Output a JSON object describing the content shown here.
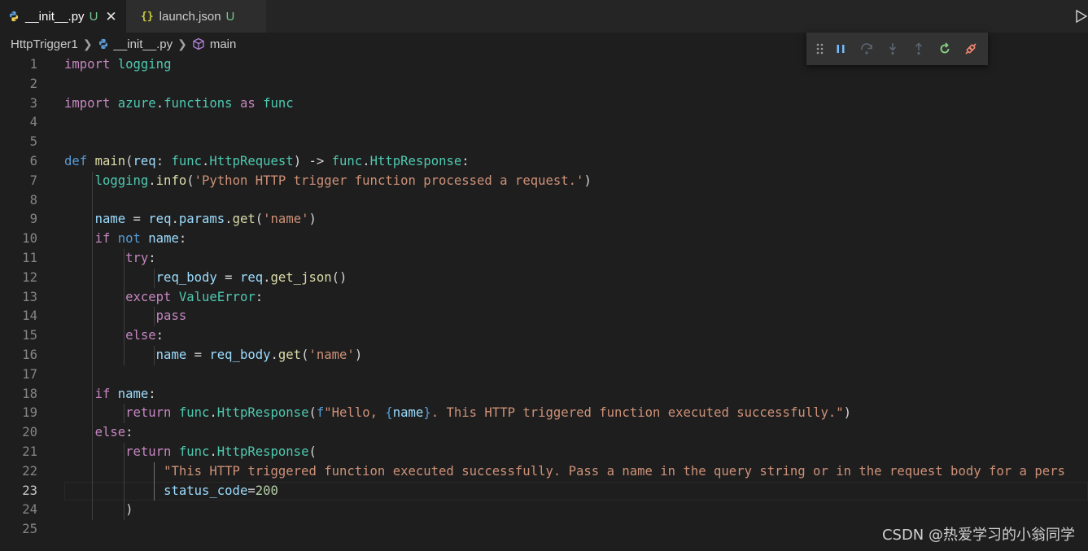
{
  "tabs": [
    {
      "label": "__init__.py",
      "status": "U"
    },
    {
      "label": "launch.json",
      "status": "U",
      "icon_text": "{}"
    }
  ],
  "breadcrumb": {
    "items": [
      "HttpTrigger1",
      "__init__.py",
      "main"
    ]
  },
  "debug_toolbar": {
    "buttons": [
      "drag-grip",
      "pause",
      "step-over",
      "step-into",
      "step-out",
      "restart",
      "disconnect"
    ]
  },
  "editor": {
    "language": "python",
    "current_line": 23,
    "lines": [
      {
        "n": "1",
        "tokens": [
          [
            "import",
            "kw"
          ],
          [
            " ",
            "p"
          ],
          [
            "logging",
            "cls"
          ]
        ]
      },
      {
        "n": "2",
        "tokens": []
      },
      {
        "n": "3",
        "tokens": [
          [
            "import",
            "kw"
          ],
          [
            " ",
            "p"
          ],
          [
            "azure",
            "cls"
          ],
          [
            ".",
            "p"
          ],
          [
            "functions",
            "cls"
          ],
          [
            " ",
            "p"
          ],
          [
            "as",
            "kw"
          ],
          [
            " ",
            "p"
          ],
          [
            "func",
            "cls"
          ]
        ]
      },
      {
        "n": "4",
        "tokens": []
      },
      {
        "n": "5",
        "tokens": []
      },
      {
        "n": "6",
        "tokens": [
          [
            "def",
            "def"
          ],
          [
            " ",
            "p"
          ],
          [
            "main",
            "fn"
          ],
          [
            "(",
            "p"
          ],
          [
            "req",
            "var"
          ],
          [
            ": ",
            "p"
          ],
          [
            "func",
            "cls"
          ],
          [
            ".",
            "p"
          ],
          [
            "HttpRequest",
            "cls"
          ],
          [
            ") -> ",
            "p"
          ],
          [
            "func",
            "cls"
          ],
          [
            ".",
            "p"
          ],
          [
            "HttpResponse",
            "cls"
          ],
          [
            ":",
            "p"
          ]
        ]
      },
      {
        "n": "7",
        "tokens": [
          [
            "    ",
            "p"
          ],
          [
            "logging",
            "cls"
          ],
          [
            ".",
            "p"
          ],
          [
            "info",
            "fn"
          ],
          [
            "(",
            "p"
          ],
          [
            "'Python HTTP trigger function processed a request.'",
            "str"
          ],
          [
            ")",
            "p"
          ]
        ]
      },
      {
        "n": "8",
        "tokens": []
      },
      {
        "n": "9",
        "tokens": [
          [
            "    ",
            "p"
          ],
          [
            "name",
            "var"
          ],
          [
            " = ",
            "p"
          ],
          [
            "req",
            "var"
          ],
          [
            ".",
            "p"
          ],
          [
            "params",
            "var"
          ],
          [
            ".",
            "p"
          ],
          [
            "get",
            "fn"
          ],
          [
            "(",
            "p"
          ],
          [
            "'name'",
            "str"
          ],
          [
            ")",
            "p"
          ]
        ]
      },
      {
        "n": "10",
        "tokens": [
          [
            "    ",
            "p"
          ],
          [
            "if",
            "kw"
          ],
          [
            " ",
            "p"
          ],
          [
            "not",
            "def"
          ],
          [
            " ",
            "p"
          ],
          [
            "name",
            "var"
          ],
          [
            ":",
            "p"
          ]
        ]
      },
      {
        "n": "11",
        "tokens": [
          [
            "        ",
            "p"
          ],
          [
            "try",
            "kw"
          ],
          [
            ":",
            "p"
          ]
        ]
      },
      {
        "n": "12",
        "tokens": [
          [
            "            ",
            "p"
          ],
          [
            "req_body",
            "var"
          ],
          [
            " = ",
            "p"
          ],
          [
            "req",
            "var"
          ],
          [
            ".",
            "p"
          ],
          [
            "get_json",
            "fn"
          ],
          [
            "()",
            "p"
          ]
        ]
      },
      {
        "n": "13",
        "tokens": [
          [
            "        ",
            "p"
          ],
          [
            "except",
            "kw"
          ],
          [
            " ",
            "p"
          ],
          [
            "ValueError",
            "cls"
          ],
          [
            ":",
            "p"
          ]
        ]
      },
      {
        "n": "14",
        "tokens": [
          [
            "            ",
            "p"
          ],
          [
            "pass",
            "kw"
          ]
        ]
      },
      {
        "n": "15",
        "tokens": [
          [
            "        ",
            "p"
          ],
          [
            "else",
            "kw"
          ],
          [
            ":",
            "p"
          ]
        ]
      },
      {
        "n": "16",
        "tokens": [
          [
            "            ",
            "p"
          ],
          [
            "name",
            "var"
          ],
          [
            " = ",
            "p"
          ],
          [
            "req_body",
            "var"
          ],
          [
            ".",
            "p"
          ],
          [
            "get",
            "fn"
          ],
          [
            "(",
            "p"
          ],
          [
            "'name'",
            "str"
          ],
          [
            ")",
            "p"
          ]
        ]
      },
      {
        "n": "17",
        "tokens": []
      },
      {
        "n": "18",
        "tokens": [
          [
            "    ",
            "p"
          ],
          [
            "if",
            "kw"
          ],
          [
            " ",
            "p"
          ],
          [
            "name",
            "var"
          ],
          [
            ":",
            "p"
          ]
        ]
      },
      {
        "n": "19",
        "tokens": [
          [
            "        ",
            "p"
          ],
          [
            "return",
            "kw"
          ],
          [
            " ",
            "p"
          ],
          [
            "func",
            "cls"
          ],
          [
            ".",
            "p"
          ],
          [
            "HttpResponse",
            "cls"
          ],
          [
            "(",
            "p"
          ],
          [
            "f",
            "def"
          ],
          [
            "\"Hello, ",
            "str"
          ],
          [
            "{",
            "brace"
          ],
          [
            "name",
            "var"
          ],
          [
            "}",
            "brace"
          ],
          [
            ". This HTTP triggered function executed successfully.\"",
            "str"
          ],
          [
            ")",
            "p"
          ]
        ]
      },
      {
        "n": "20",
        "tokens": [
          [
            "    ",
            "p"
          ],
          [
            "else",
            "kw"
          ],
          [
            ":",
            "p"
          ]
        ]
      },
      {
        "n": "21",
        "tokens": [
          [
            "        ",
            "p"
          ],
          [
            "return",
            "kw"
          ],
          [
            " ",
            "p"
          ],
          [
            "func",
            "cls"
          ],
          [
            ".",
            "p"
          ],
          [
            "HttpResponse",
            "cls"
          ],
          [
            "(",
            "p"
          ]
        ]
      },
      {
        "n": "22",
        "tokens": [
          [
            "             ",
            "p"
          ],
          [
            "\"This HTTP triggered function executed successfully. Pass a name in the query string or in the request body for a pers",
            "str"
          ]
        ]
      },
      {
        "n": "23",
        "tokens": [
          [
            "             ",
            "p"
          ],
          [
            "status_code",
            "var"
          ],
          [
            "=",
            "p"
          ],
          [
            "200",
            "num"
          ]
        ]
      },
      {
        "n": "24",
        "tokens": [
          [
            "        ",
            "p"
          ],
          [
            ")",
            "p"
          ]
        ]
      },
      {
        "n": "25",
        "tokens": []
      }
    ]
  },
  "watermark": "CSDN @热爱学习的小翁同学",
  "colors": {
    "background": "#1e1e1e",
    "tabbar": "#252526",
    "keyword": "#c586c0",
    "string": "#ce9178",
    "function": "#dcdcaa",
    "class": "#4ec9b0",
    "variable": "#9cdcfe",
    "modified": "#73c991"
  }
}
